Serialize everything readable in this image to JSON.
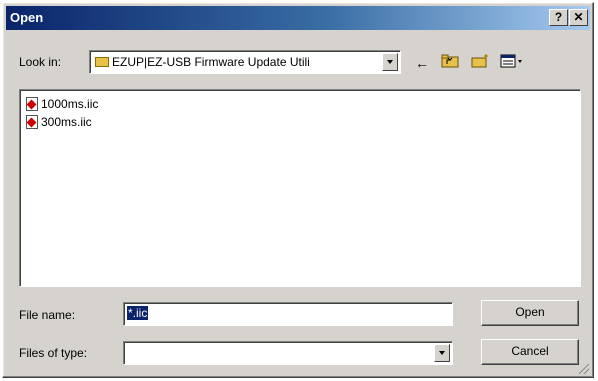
{
  "window": {
    "title": "Open",
    "help_label": "?",
    "close_label": "✕"
  },
  "lookin": {
    "label": "Look in:",
    "value": "EZUP|EZ-USB Firmware Update Utili"
  },
  "files": [
    {
      "name": "1000ms.iic"
    },
    {
      "name": "300ms.iic"
    }
  ],
  "filename": {
    "label": "File name:",
    "value": "*.iic"
  },
  "filetype": {
    "label": "Files of type:",
    "value": ""
  },
  "buttons": {
    "open": "Open",
    "cancel": "Cancel"
  },
  "toolbar": {
    "back": "back-arrow-icon",
    "up": "folder-up-icon",
    "new_folder": "new-folder-icon",
    "views": "view-menu-icon"
  }
}
